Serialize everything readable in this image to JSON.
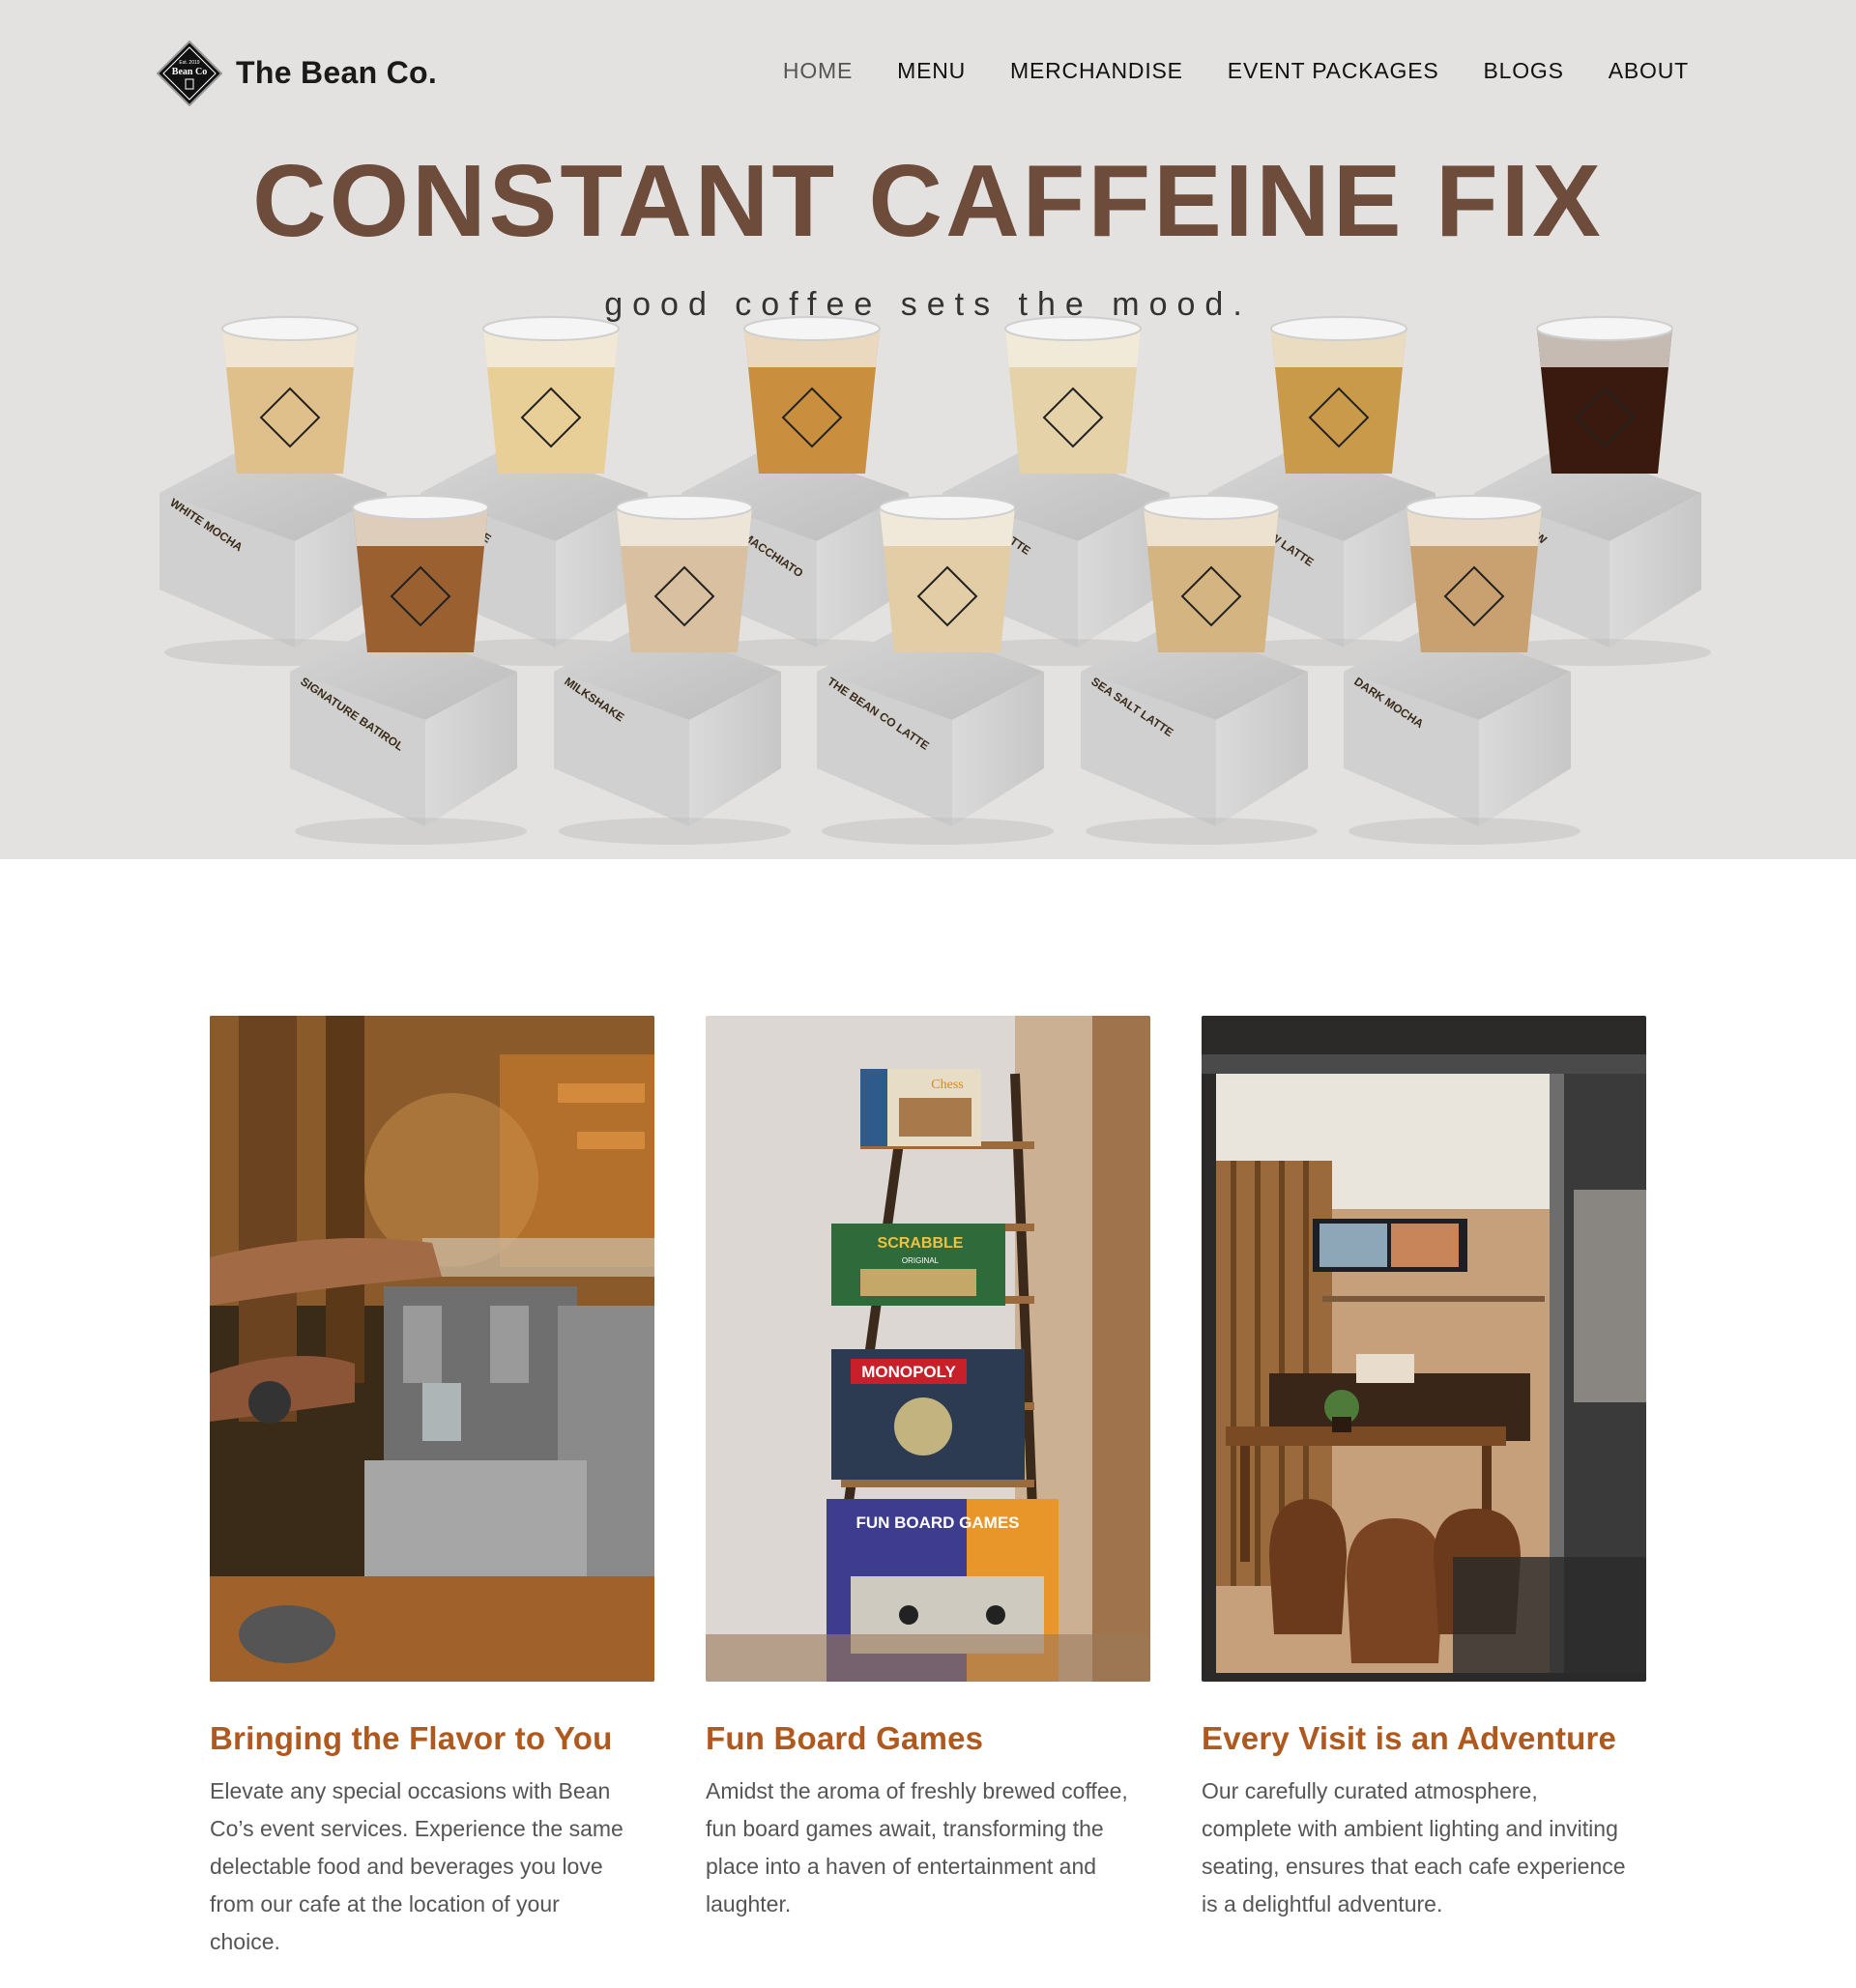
{
  "nav": {
    "brand": "The Bean Co.",
    "logo_lines": [
      "Est. 2019",
      "Bean Co"
    ],
    "items": [
      {
        "label": "HOME",
        "active": true
      },
      {
        "label": "MENU"
      },
      {
        "label": "MERCHANDISE"
      },
      {
        "label": "EVENT PACKAGES"
      },
      {
        "label": "BLOGS"
      },
      {
        "label": "ABOUT"
      }
    ]
  },
  "hero": {
    "title": "CONSTANT CAFFEINE FIX",
    "subtitle": "good coffee sets the mood.",
    "drinks": [
      "WHITE MOCHA",
      "FLAT WHITE",
      "CARAMEL MACCHIATO",
      "SPANISH LATTE",
      "COLD BREW LATTE",
      "COLD BREW",
      "SIGNATURE BATIROL",
      "MILKSHAKE",
      "THE BEAN CO LATTE",
      "SEA SALT LATTE",
      "DARK MOCHA"
    ]
  },
  "cards": [
    {
      "title": "Bringing the Flavor to You",
      "text": "Elevate any special occasions with Bean Co’s event services. Experience the same delectable food and beverages you love from our cafe at the location of your choice."
    },
    {
      "title": "Fun Board Games",
      "text": "Amidst the aroma of freshly brewed coffee, fun board games await, transforming the place into a haven of entertainment and laughter.",
      "games": [
        "Chess",
        "SCRABBLE",
        "ORIGINAL",
        "MONOPOLY",
        "FUN BOARD GAMES"
      ]
    },
    {
      "title": "Every Visit is an Adventure",
      "text": "Our carefully curated atmosphere, complete with ambient lighting and inviting seating, ensures that each cafe experience is a delightful adventure."
    }
  ],
  "colors": {
    "hero_bg": "#e3e2e0",
    "title_brown": "#6e4c3c",
    "card_title": "#b0591e",
    "body_text": "#555555"
  }
}
